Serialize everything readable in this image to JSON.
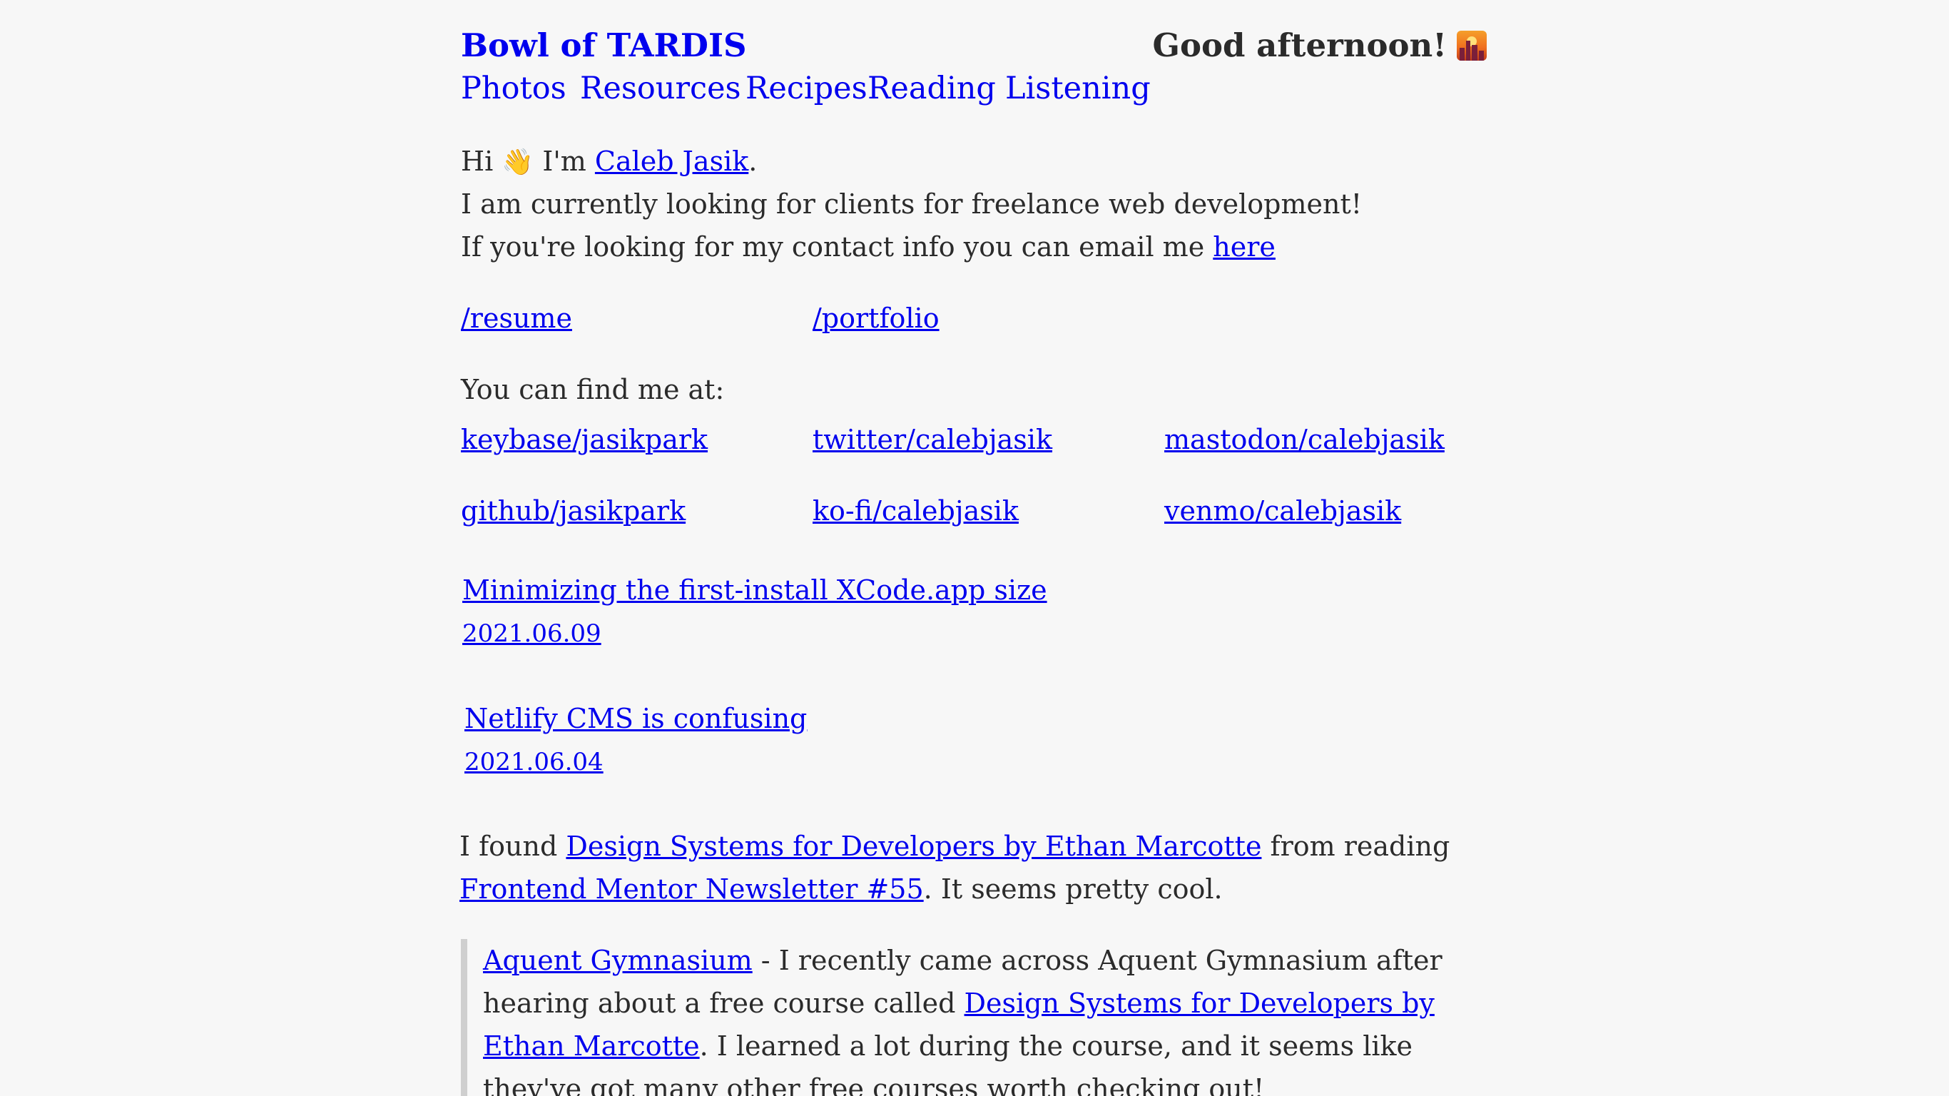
{
  "header": {
    "site_title": "Bowl of TARDIS",
    "greeting": "Good afternoon!",
    "greeting_icon": "sunset-city-icon"
  },
  "nav": {
    "items": [
      {
        "label": "Photos"
      },
      {
        "label": "Resources"
      },
      {
        "label": "Recipes"
      },
      {
        "label": "Reading"
      },
      {
        "label": "Listening"
      }
    ]
  },
  "intro": {
    "hi": "Hi",
    "wave_emoji": "👋",
    "im": "I'm",
    "name_link": "Caleb Jasik",
    "name_suffix": ".",
    "freelance": "I am currently looking for clients for freelance web development!",
    "contact_prefix": "If you're looking for my contact info you can email me",
    "contact_link": "here"
  },
  "pages": {
    "resume": "/resume",
    "portfolio": "/portfolio"
  },
  "social": {
    "heading": "You can find me at:",
    "links": [
      "keybase/jasikpark",
      "twitter/calebjasik",
      "mastodon/calebjasik",
      "github/jasikpark",
      "ko-fi/calebjasik",
      "venmo/calebjasik"
    ]
  },
  "posts": [
    {
      "title": "Minimizing the first-install XCode.app size",
      "date": "2021.06.09"
    },
    {
      "title": "Netlify CMS is confusing",
      "date": "2021.06.04"
    }
  ],
  "note": {
    "prefix": "I found",
    "link1": "Design Systems for Developers by Ethan Marcotte",
    "middle": "from reading",
    "link2": "Frontend Mentor Newsletter #55",
    "suffix": ". It seems pretty cool."
  },
  "quote": {
    "link1": "Aquent Gymnasium",
    "text1": " - I recently came across Aquent Gymnasium after hearing about a free course called ",
    "link2": "Design Systems for Developers by Ethan Marcotte",
    "text2": ". I learned a lot during the course, and it seems like they've got many other free courses worth checking out!"
  }
}
